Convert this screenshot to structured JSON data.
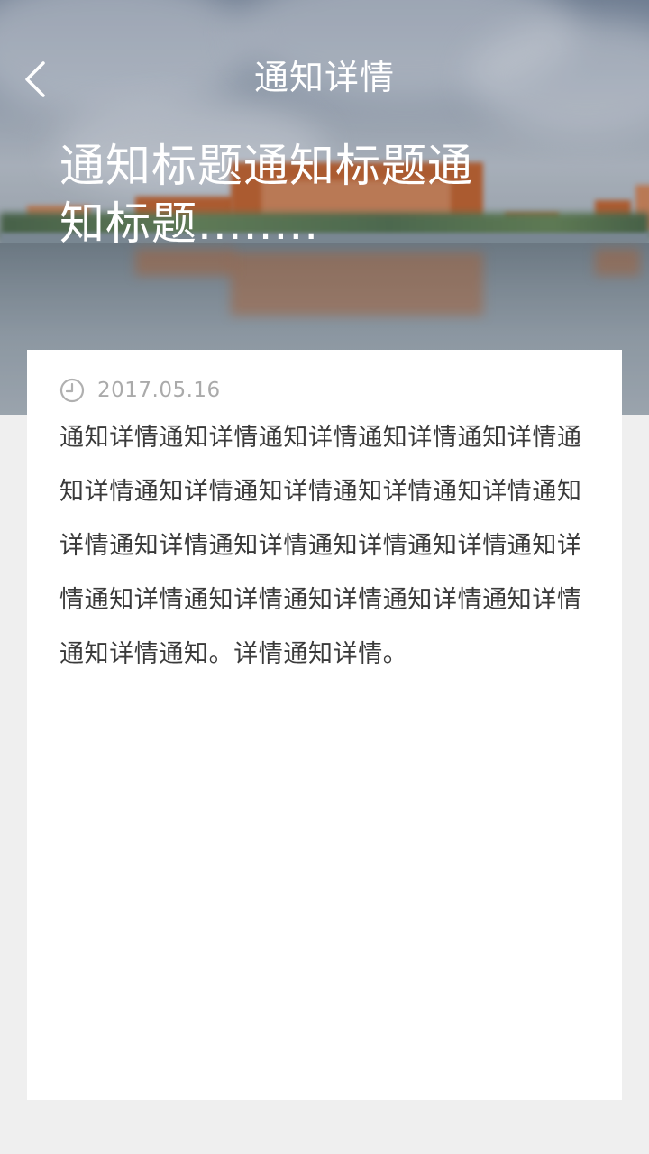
{
  "header": {
    "title": "通知详情",
    "back_icon": "chevron-left-icon"
  },
  "notice": {
    "title": "通知标题通知标题通知标题........",
    "date": "2017.05.16",
    "date_icon": "clock-icon",
    "content": "通知详情通知详情通知详情通知详情通知详情通知详情通知详情通知详情通知详情通知详情通知详情通知详情通知详情通知详情通知详情通知详情通知详情通知详情通知详情通知详情通知详情通知详情通知。详情通知详情。"
  },
  "colors": {
    "page_background": "#efefef",
    "card_background": "#ffffff",
    "header_text": "#ffffff",
    "date_text": "#aaaaaa",
    "body_text": "#3a3a3a"
  }
}
